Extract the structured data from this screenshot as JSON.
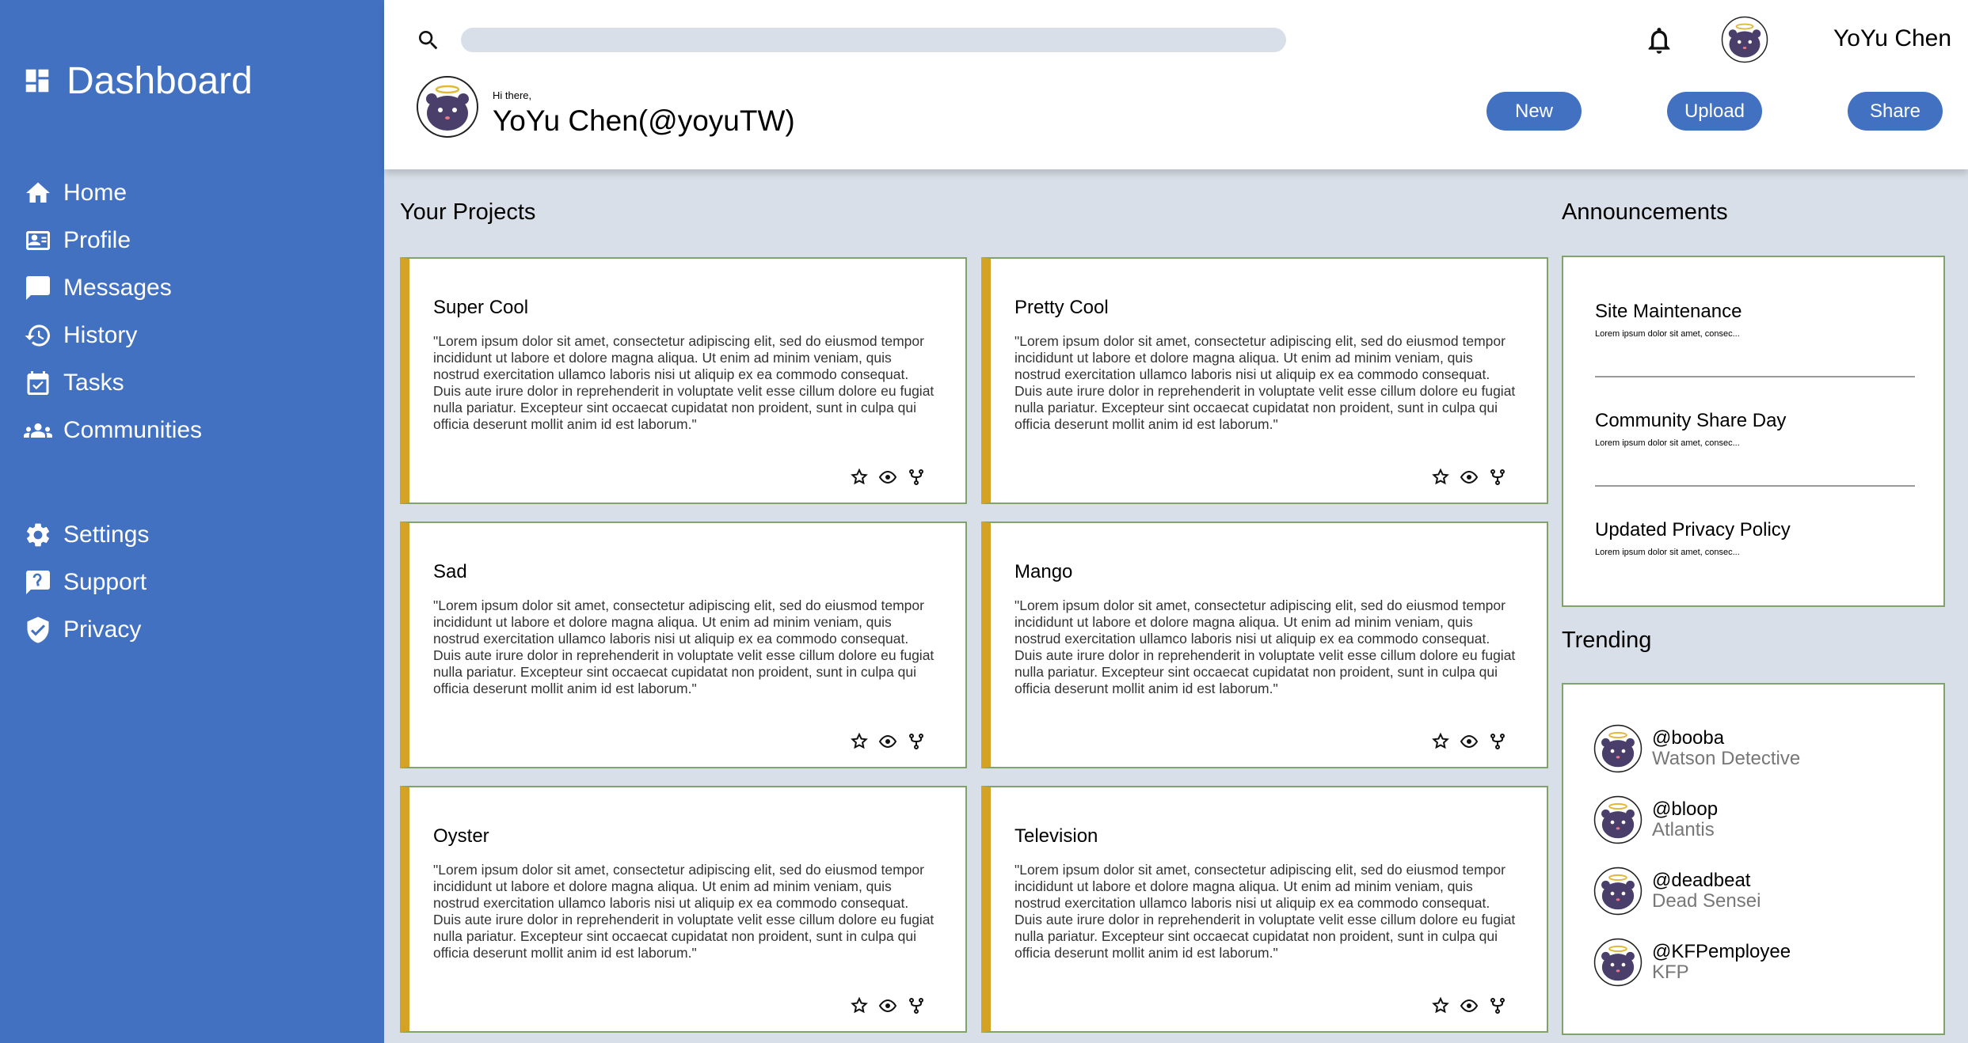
{
  "sidebar": {
    "brand": "Dashboard",
    "main_items": [
      {
        "label": "Home",
        "icon": "home-icon"
      },
      {
        "label": "Profile",
        "icon": "profile-card-icon"
      },
      {
        "label": "Messages",
        "icon": "message-icon"
      },
      {
        "label": "History",
        "icon": "history-icon"
      },
      {
        "label": "Tasks",
        "icon": "tasks-icon"
      },
      {
        "label": "Communities",
        "icon": "communities-icon"
      }
    ],
    "secondary_items": [
      {
        "label": "Settings",
        "icon": "gear-icon"
      },
      {
        "label": "Support",
        "icon": "support-icon"
      },
      {
        "label": "Privacy",
        "icon": "shield-icon"
      }
    ]
  },
  "header": {
    "search_placeholder": "",
    "user_name": "YoYu Chen",
    "greeting_small": "Hi there,",
    "greeting_name": "YoYu Chen(@yoyuTW)",
    "buttons": {
      "new": "New",
      "upload": "Upload",
      "share": "Share"
    }
  },
  "projects": {
    "title": "Your Projects",
    "items": [
      {
        "title": "Super Cool",
        "body": "\"Lorem ipsum dolor sit amet, consectetur adipiscing elit, sed do eiusmod tempor incididunt ut labore et dolore magna aliqua. Ut enim ad minim veniam, quis nostrud exercitation ullamco laboris nisi ut aliquip ex ea commodo consequat. Duis aute irure dolor in reprehenderit in voluptate velit esse cillum dolore eu fugiat nulla pariatur. Excepteur sint occaecat cupidatat non proident, sunt in culpa qui officia deserunt mollit anim id est laborum.\""
      },
      {
        "title": "Pretty Cool",
        "body": "\"Lorem ipsum dolor sit amet, consectetur adipiscing elit, sed do eiusmod tempor incididunt ut labore et dolore magna aliqua. Ut enim ad minim veniam, quis nostrud exercitation ullamco laboris nisi ut aliquip ex ea commodo consequat. Duis aute irure dolor in reprehenderit in voluptate velit esse cillum dolore eu fugiat nulla pariatur. Excepteur sint occaecat cupidatat non proident, sunt in culpa qui officia deserunt mollit anim id est laborum.\""
      },
      {
        "title": "Sad",
        "body": "\"Lorem ipsum dolor sit amet, consectetur adipiscing elit, sed do eiusmod tempor incididunt ut labore et dolore magna aliqua. Ut enim ad minim veniam, quis nostrud exercitation ullamco laboris nisi ut aliquip ex ea commodo consequat. Duis aute irure dolor in reprehenderit in voluptate velit esse cillum dolore eu fugiat nulla pariatur. Excepteur sint occaecat cupidatat non proident, sunt in culpa qui officia deserunt mollit anim id est laborum.\""
      },
      {
        "title": "Mango",
        "body": "\"Lorem ipsum dolor sit amet, consectetur adipiscing elit, sed do eiusmod tempor incididunt ut labore et dolore magna aliqua. Ut enim ad minim veniam, quis nostrud exercitation ullamco laboris nisi ut aliquip ex ea commodo consequat. Duis aute irure dolor in reprehenderit in voluptate velit esse cillum dolore eu fugiat nulla pariatur. Excepteur sint occaecat cupidatat non proident, sunt in culpa qui officia deserunt mollit anim id est laborum.\""
      },
      {
        "title": "Oyster",
        "body": "\"Lorem ipsum dolor sit amet, consectetur adipiscing elit, sed do eiusmod tempor incididunt ut labore et dolore magna aliqua. Ut enim ad minim veniam, quis nostrud exercitation ullamco laboris nisi ut aliquip ex ea commodo consequat. Duis aute irure dolor in reprehenderit in voluptate velit esse cillum dolore eu fugiat nulla pariatur. Excepteur sint occaecat cupidatat non proident, sunt in culpa qui officia deserunt mollit anim id est laborum.\""
      },
      {
        "title": "Television",
        "body": "\"Lorem ipsum dolor sit amet, consectetur adipiscing elit, sed do eiusmod tempor incididunt ut labore et dolore magna aliqua. Ut enim ad minim veniam, quis nostrud exercitation ullamco laboris nisi ut aliquip ex ea commodo consequat. Duis aute irure dolor in reprehenderit in voluptate velit esse cillum dolore eu fugiat nulla pariatur. Excepteur sint occaecat cupidatat non proident, sunt in culpa qui officia deserunt mollit anim id est laborum.\""
      }
    ]
  },
  "announcements": {
    "title": "Announcements",
    "items": [
      {
        "title": "Site Maintenance",
        "text": "Lorem ipsum dolor sit amet, consec..."
      },
      {
        "title": "Community Share Day",
        "text": "Lorem ipsum dolor sit amet, consec..."
      },
      {
        "title": "Updated Privacy Policy",
        "text": "Lorem ipsum dolor sit amet, consec..."
      }
    ]
  },
  "trending": {
    "title": "Trending",
    "items": [
      {
        "handle": "@booba",
        "name": "Watson Detective"
      },
      {
        "handle": "@bloop",
        "name": "Atlantis"
      },
      {
        "handle": "@deadbeat",
        "name": "Dead Sensei"
      },
      {
        "handle": "@KFPemployee",
        "name": "KFP"
      }
    ]
  },
  "colors": {
    "sidebar": "#4371c2",
    "accent_button": "#4371c2",
    "card_accent": "#d4a324",
    "card_border": "#7fa36b",
    "background": "#d9dfe8"
  }
}
